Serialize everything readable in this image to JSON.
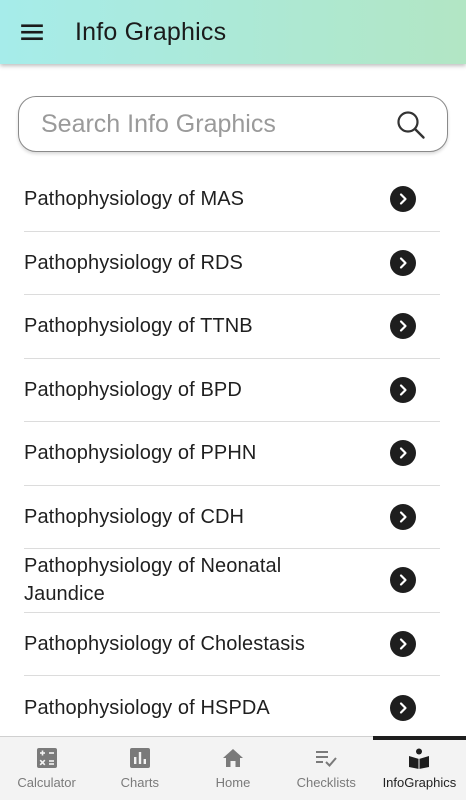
{
  "app_bar": {
    "title": "Info Graphics",
    "menu_icon": "hamburger-menu-icon"
  },
  "search": {
    "placeholder": "Search Info Graphics",
    "value": "",
    "icon": "search-icon"
  },
  "list": {
    "items": [
      {
        "label": "Pathophysiology of MAS"
      },
      {
        "label": "Pathophysiology of RDS"
      },
      {
        "label": "Pathophysiology of TTNB"
      },
      {
        "label": "Pathophysiology of BPD"
      },
      {
        "label": "Pathophysiology of PPHN"
      },
      {
        "label": "Pathophysiology of CDH"
      },
      {
        "label": "Pathophysiology of Neonatal Jaundice"
      },
      {
        "label": "Pathophysiology of Cholestasis"
      },
      {
        "label": "Pathophysiology of HSPDA"
      }
    ]
  },
  "bottom_nav": {
    "items": [
      {
        "label": "Calculator",
        "icon": "calculator-icon"
      },
      {
        "label": "Charts",
        "icon": "bar-chart-icon"
      },
      {
        "label": "Home",
        "icon": "home-icon"
      },
      {
        "label": "Checklists",
        "icon": "checklist-icon"
      },
      {
        "label": "InfoGraphics",
        "icon": "reader-book-icon",
        "active": true
      }
    ]
  },
  "colors": {
    "header_start": "#a6ecea",
    "header_end": "#b2e6c4",
    "chevron_bg": "#1e1e1e",
    "nav_bg": "#f3f3f3"
  }
}
